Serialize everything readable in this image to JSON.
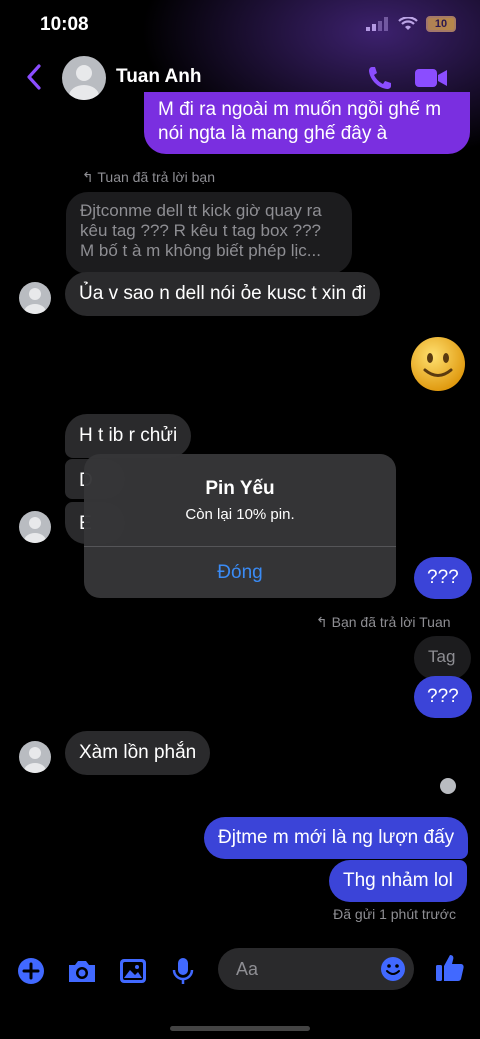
{
  "status_bar": {
    "time": "10:08",
    "battery": "10"
  },
  "header": {
    "contact_name": "Tuan Anh"
  },
  "messages": {
    "top_out": "M đi ra ngoài m muốn ngồi ghế m nói ngta là mang ghế đây à",
    "reply_note_1": "Tuan đã trả lời bạn",
    "quoted_1": "Đjtconme dell tt kick giờ quay ra kêu tag ??? R kêu t tag box ??? M bố t à m không biết phép lịc...",
    "in_1": "Ủa v sao n dell nói ỏe kusc t xin đi",
    "in_2": "H t ib r chửi",
    "in_3_partial": "D",
    "in_4_partial": "E",
    "out_q1": "???",
    "reply_note_2": "Bạn đã trả lời Tuan",
    "quoted_2": "Tag",
    "out_q2": "???",
    "in_5": "Xàm lồn phắn",
    "out_1": "Đjtme m mới là ng lượn đấy",
    "out_2": "Thg nhảm lol",
    "sent_status": "Đã gửi 1 phút trước"
  },
  "alert": {
    "title": "Pin Yếu",
    "message": "Còn lại 10% pin.",
    "button": "Đóng"
  },
  "composer": {
    "placeholder": "Aa"
  },
  "colors": {
    "accent": "#7a2fe0",
    "outgoing_blue": "#3b44d8",
    "incoming": "#2a2a2c",
    "link_blue": "#3a8bf5"
  }
}
